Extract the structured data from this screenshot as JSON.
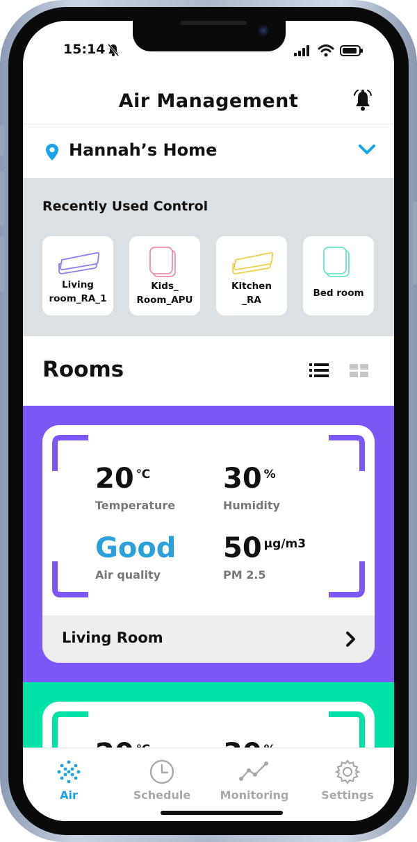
{
  "status_bar": {
    "time": "15:14"
  },
  "header": {
    "title": "Air Management"
  },
  "home_selector": {
    "name": "Hannah’s Home"
  },
  "recent": {
    "title": "Recently Used Control",
    "items": [
      {
        "label": "Living\nroom_RA_1",
        "color": "#8a7df0",
        "device": "air-conditioner"
      },
      {
        "label": "Kids_\nRoom_APU",
        "color": "#f08cb0",
        "device": "air-purifier"
      },
      {
        "label": "Kitchen\n_RA",
        "color": "#ecd24a",
        "device": "air-conditioner"
      },
      {
        "label": "Bed room",
        "color": "#67e6c6",
        "device": "air-purifier"
      }
    ]
  },
  "rooms": {
    "title": "Rooms",
    "cards": [
      {
        "name": "Living Room",
        "theme_color": "#7b57f6",
        "temperature": {
          "value": "20",
          "unit": "℃",
          "label": "Temperature"
        },
        "humidity": {
          "value": "30",
          "unit": "%",
          "label": "Humidity"
        },
        "air_quality": {
          "value": "Good",
          "label": "Air quality",
          "color": "#2a9fd8"
        },
        "pm25": {
          "value": "50",
          "unit": "μg/m3",
          "label": "PM 2.5"
        }
      },
      {
        "name": "",
        "theme_color": "#00e2a6",
        "temperature": {
          "value": "20",
          "unit": "℃"
        },
        "humidity": {
          "value": "30",
          "unit": "%"
        }
      }
    ]
  },
  "nav": {
    "items": [
      {
        "label": "Air",
        "active": true,
        "icon": "air-dots-icon"
      },
      {
        "label": "Schedule",
        "active": false,
        "icon": "clock-icon"
      },
      {
        "label": "Monitoring",
        "active": false,
        "icon": "line-chart-icon"
      },
      {
        "label": "Settings",
        "active": false,
        "icon": "gear-icon"
      }
    ],
    "active_color": "#1aa3e8",
    "inactive_color": "#a8a8a8"
  },
  "colors": {
    "accent_blue": "#1aa3e8",
    "recent_bg": "#dbe0e5"
  }
}
